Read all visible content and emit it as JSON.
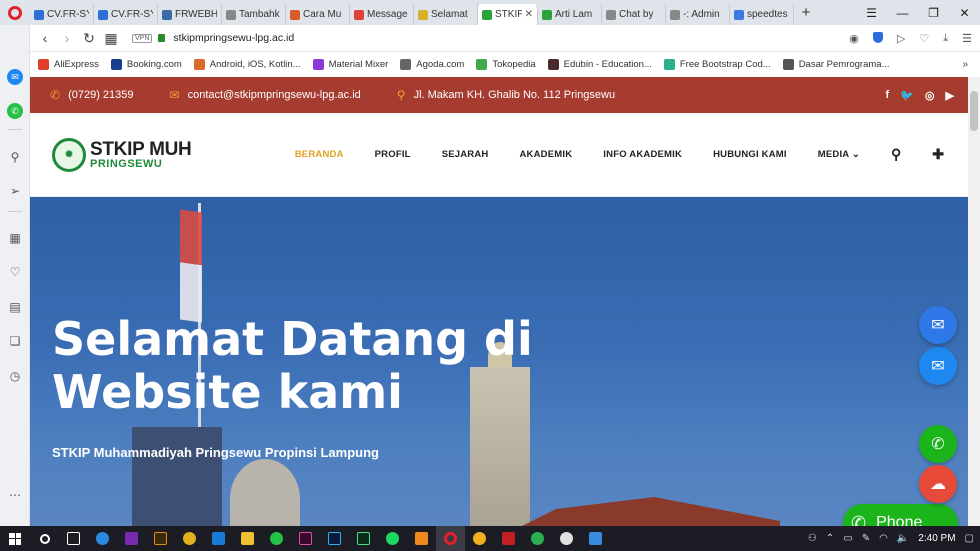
{
  "browser": {
    "tabs": [
      {
        "title": "CV.FR-SY",
        "color": "#2d6fd6"
      },
      {
        "title": "CV.FR-SY",
        "color": "#2d6fd6"
      },
      {
        "title": "FRWEBH",
        "color": "#3a6aa8"
      },
      {
        "title": "Tambahk",
        "color": "#888888"
      },
      {
        "title": "Cara Mu",
        "color": "#d85c2a"
      },
      {
        "title": "Message",
        "color": "#e0403a"
      },
      {
        "title": "Selamat",
        "color": "#d8b02a"
      },
      {
        "title": "STKIP",
        "color": "#2aa23a",
        "active": true
      },
      {
        "title": "Arti Lam",
        "color": "#2aa23a"
      },
      {
        "title": "Chat by",
        "color": "#888888"
      },
      {
        "title": "-: Admin",
        "color": "#888888"
      },
      {
        "title": "speedtes",
        "color": "#3a7ae0"
      }
    ],
    "new_tab": "+",
    "address": {
      "vpn": "VPN",
      "url": "stkipmpringsewu-lpg.ac.id"
    },
    "bookmarks": [
      {
        "label": "AliExpress",
        "color": "#e0402a"
      },
      {
        "label": "Booking.com",
        "color": "#1a3f8a"
      },
      {
        "label": "Android, iOS, Kotlin...",
        "color": "#d86a2a"
      },
      {
        "label": "Material Mixer",
        "color": "#8a3ad8"
      },
      {
        "label": "Agoda.com",
        "color": "#666666"
      },
      {
        "label": "Tokopedia",
        "color": "#42a84a"
      },
      {
        "label": "Edubin - Education...",
        "color": "#4a2a2a"
      },
      {
        "label": "Free Bootstrap Cod...",
        "color": "#2ab08a"
      },
      {
        "label": "Dasar Pemrograma...",
        "color": "#555555"
      }
    ],
    "bookmarks_more": "»"
  },
  "site": {
    "topbar": {
      "phone": "(0729) 21359",
      "email": "contact@stkipmpringsewu-lpg.ac.id",
      "address": "Jl. Makam KH. Ghalib No. 112 Pringsewu",
      "social": [
        "f",
        "t",
        "ig",
        "yt"
      ]
    },
    "logo": {
      "main": "STKIP MUH",
      "sub": "PRINGSEWU"
    },
    "menu": [
      {
        "label": "BERANDA",
        "active": true
      },
      {
        "label": "PROFIL"
      },
      {
        "label": "SEJARAH"
      },
      {
        "label": "AKADEMIK"
      },
      {
        "label": "INFO AKADEMIK"
      },
      {
        "label": "HUBUNGI KAMI"
      },
      {
        "label": "MEDIA ⌄"
      }
    ],
    "hero": {
      "title_line1": "Selamat Datang di",
      "title_line2": "Website kami",
      "subtitle": "STKIP Muhammadiyah Pringsewu Propinsi Lampung"
    },
    "floating": {
      "phone_label": "Phone"
    }
  },
  "taskbar": {
    "time": "2:40 PM"
  },
  "colors": {
    "topbar": "#a63b30",
    "accent": "#e0a020",
    "phone_green": "#1bb41b"
  }
}
